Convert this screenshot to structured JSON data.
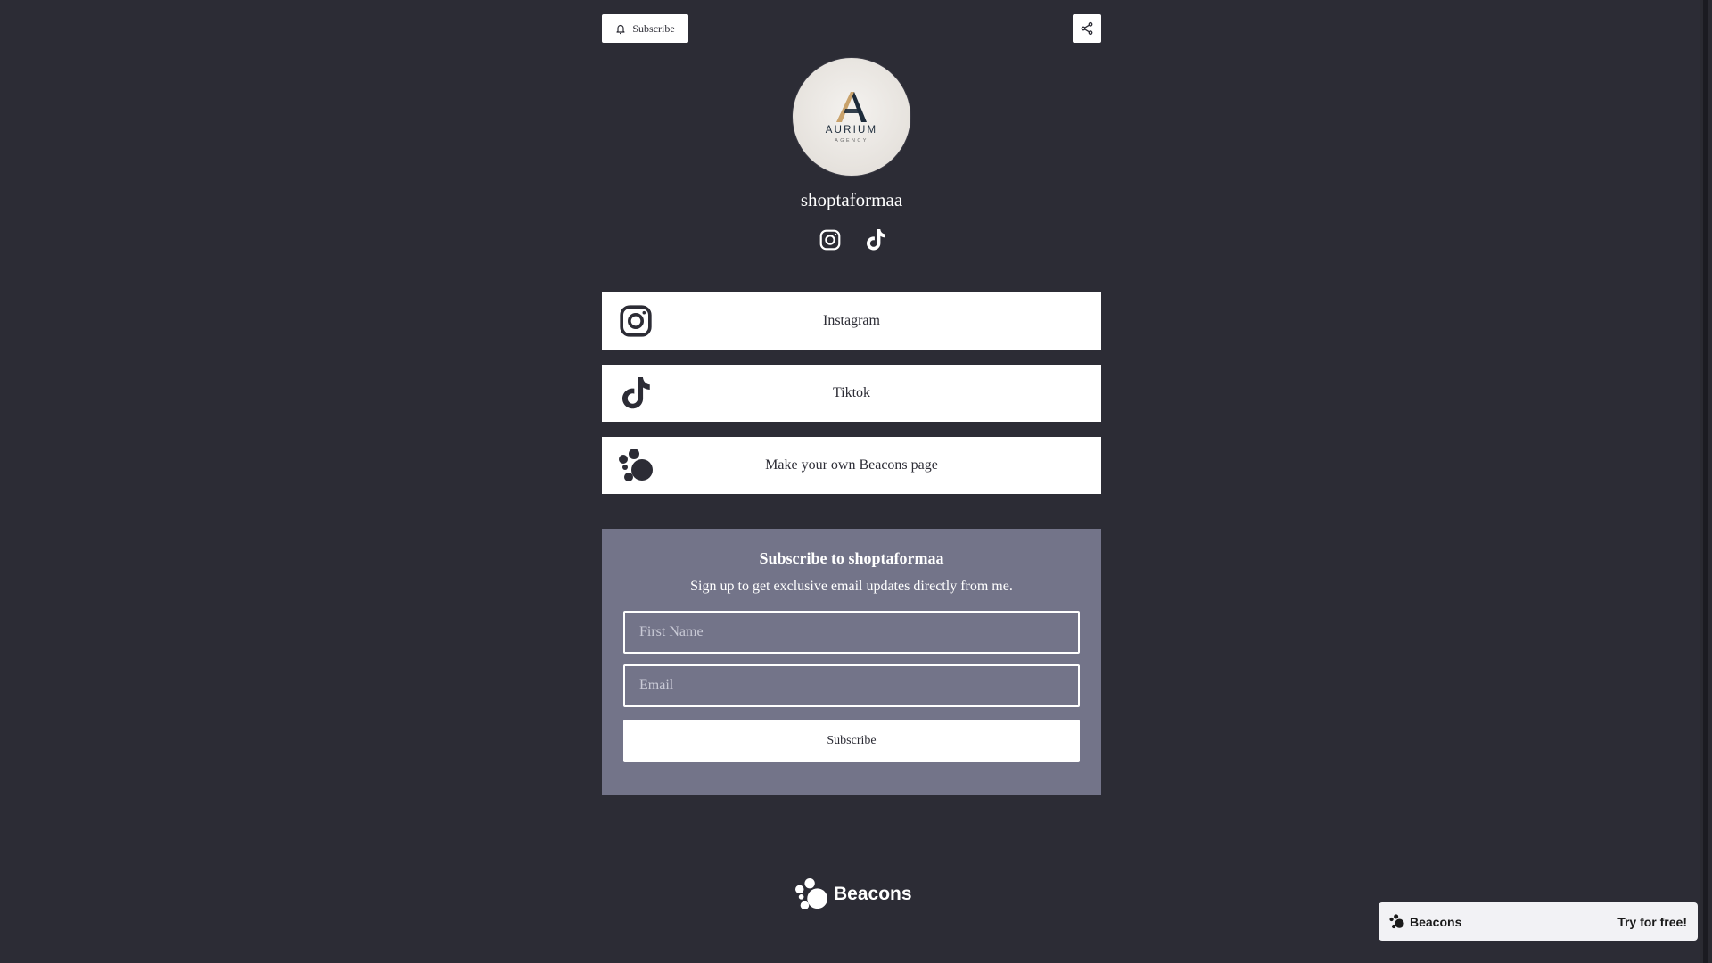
{
  "header": {
    "subscribe_label": "Subscribe"
  },
  "profile": {
    "username": "shoptaformaa",
    "logo": {
      "brand": "AURIUM",
      "sub": "AGENCY"
    }
  },
  "social_icons": [
    "instagram-icon",
    "tiktok-icon"
  ],
  "links": [
    {
      "label": "Instagram",
      "icon": "instagram-icon"
    },
    {
      "label": "Tiktok",
      "icon": "tiktok-icon"
    },
    {
      "label": "Make your own Beacons page",
      "icon": "beacons-icon"
    }
  ],
  "subscribe_card": {
    "title": "Subscribe to shoptaformaa",
    "description": "Sign up to get exclusive email updates directly from me.",
    "first_name_placeholder": "First Name",
    "email_placeholder": "Email",
    "submit_label": "Subscribe"
  },
  "footer": {
    "wordmark": "Beacons"
  },
  "promo": {
    "brand": "Beacons",
    "cta": "Try for free!"
  },
  "colors": {
    "background": "#2c2c35",
    "card": "#737489",
    "button": "#ffffff",
    "logo_gold": "#c9a26b",
    "logo_navy": "#1d2b3a"
  }
}
